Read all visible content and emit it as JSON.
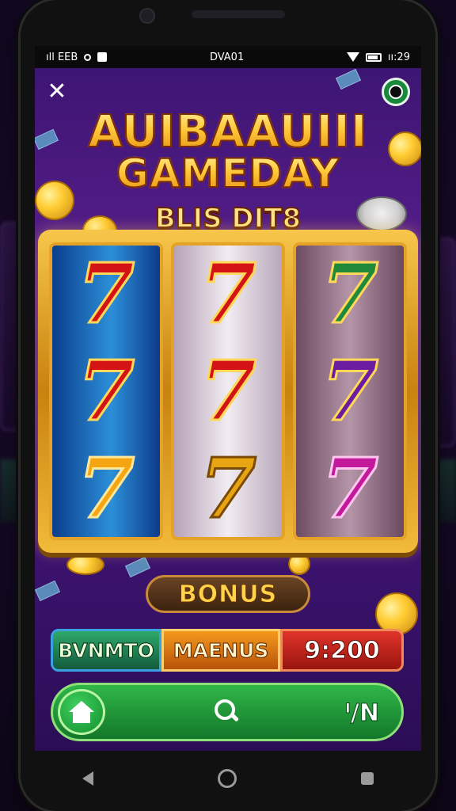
{
  "status_bar": {
    "left_text": "ıll EEB",
    "center_text": "DVA01",
    "right_text": "ıı:29"
  },
  "header": {
    "close_glyph": "✕",
    "title_line1": "AUIBAAUIII",
    "title_line2": "GAMEDAY",
    "subtitle": "BLIS DIT8"
  },
  "reels": [
    {
      "theme": "blue",
      "symbols": [
        "7",
        "7",
        "7"
      ],
      "colors": [
        "red",
        "red",
        "orange"
      ]
    },
    {
      "theme": "silver",
      "symbols": [
        "7",
        "7",
        "7"
      ],
      "colors": [
        "red",
        "red",
        "gold"
      ]
    },
    {
      "theme": "mauve",
      "symbols": [
        "7",
        "7",
        "7"
      ],
      "colors": [
        "green",
        "purple",
        "magenta"
      ]
    }
  ],
  "bonus_button": {
    "label": "BONUS"
  },
  "info_bar": {
    "left_label": "BVNMTO",
    "middle_label": "MAENUS",
    "amount": "9:200"
  },
  "bottom_nav": {
    "home_icon": "home-icon",
    "search_icon": "search-icon",
    "right_label": "ᴵ/N"
  },
  "colors": {
    "accent_gold": "#ffc93a",
    "nav_green": "#1e9a3a",
    "screen_purple": "#4a1880"
  }
}
